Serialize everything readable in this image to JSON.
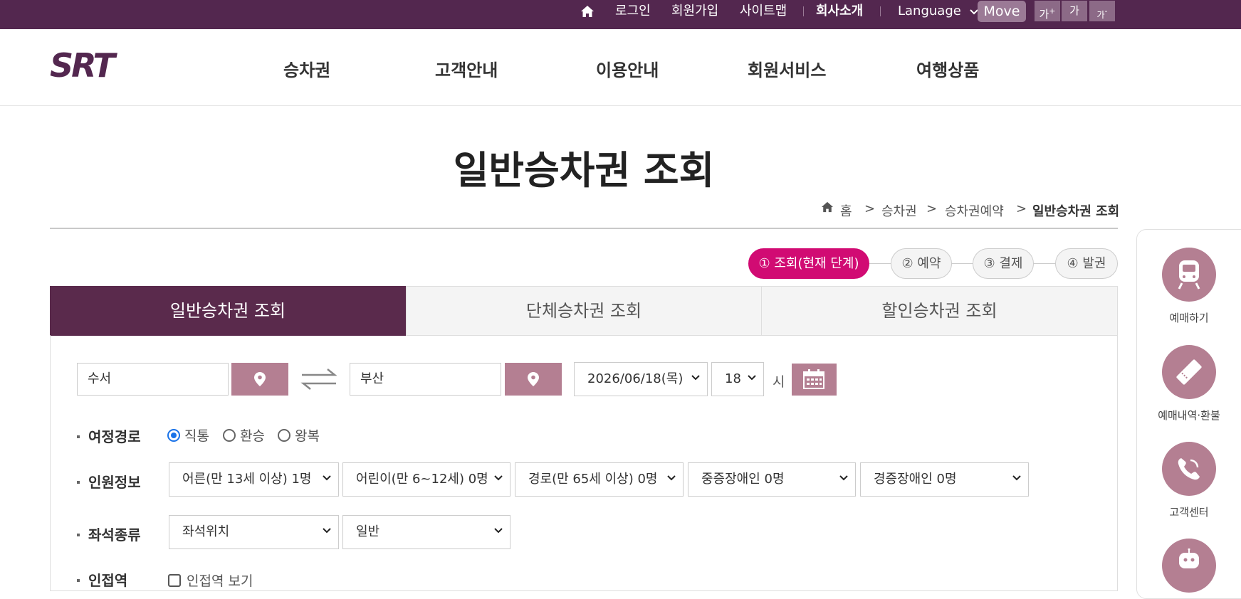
{
  "topbar": {
    "home_icon": "home-icon",
    "login": "로그인",
    "signup": "회원가입",
    "sitemap": "사이트맵",
    "company": "회사소개",
    "language": "Language",
    "move": "Move",
    "font_larger": "가",
    "font_normal": "가",
    "font_smaller": "가"
  },
  "header": {
    "logo": "SRT",
    "nav": [
      "승차권",
      "고객안내",
      "이용안내",
      "회원서비스",
      "여행상품"
    ]
  },
  "page": {
    "title": "일반승차권 조회",
    "breadcrumb": [
      "홈",
      "승차권",
      "승차권예약",
      "일반승차권 조회"
    ]
  },
  "steps": [
    "① 조회(현재 단계)",
    "② 예약",
    "③ 결제",
    "④ 발권"
  ],
  "tabs": [
    "일반승차권 조회",
    "단체승차권 조회",
    "할인승차권 조회"
  ],
  "search": {
    "departure": "수서",
    "arrival": "부산",
    "date": "2026/06/18(목)",
    "hour": "18",
    "hour_unit": "시"
  },
  "route": {
    "label": "여정경로",
    "options": [
      "직통",
      "환승",
      "왕복"
    ],
    "selected": "직통"
  },
  "passengers": {
    "label": "인원정보",
    "selects": [
      "어른(만 13세 이상) 1명",
      "어린이(만 6~12세) 0명",
      "경로(만 65세 이상) 0명",
      "중증장애인 0명",
      "경증장애인 0명"
    ]
  },
  "seat": {
    "label": "좌석종류",
    "selects": [
      "좌석위치",
      "일반"
    ]
  },
  "nearby": {
    "label": "인접역",
    "checkbox": "인접역 보기"
  },
  "quick_menu": [
    "예매하기",
    "예매내역·환불",
    "고객센터"
  ],
  "colors": {
    "topbar": "#53274f",
    "active_tab": "#5a2a4c",
    "step_active": "#d10b73",
    "button": "#b47f92"
  }
}
